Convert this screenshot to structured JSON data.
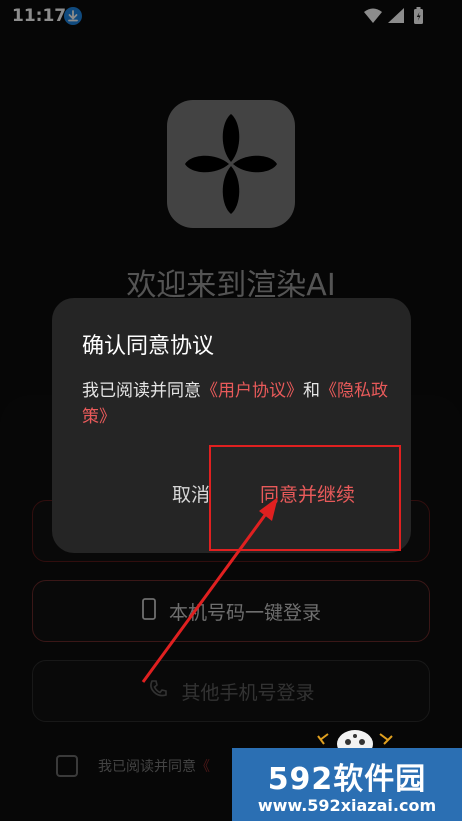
{
  "status_bar": {
    "time": "11:17"
  },
  "welcome_title": "欢迎来到渲染AI",
  "buttons": {
    "hidden_login": "",
    "local_number_login": "本机号码一键登录",
    "other_phone_login": "其他手机号登录"
  },
  "agreement_row": {
    "text_prefix": "我已阅读并同意",
    "link_partial": "《"
  },
  "dialog": {
    "title": "确认同意协议",
    "body_prefix": "我已阅读并同意",
    "user_agreement": "《用户协议》",
    "and": "和",
    "privacy_policy": "《隐私政策》",
    "cancel_label": "取消",
    "accept_label": "同意并继续"
  },
  "watermark": {
    "main": "592软件园",
    "url": "www.592xiazai.com"
  },
  "colors": {
    "accent_red": "#e85a5a",
    "annotation_red": "#e02020",
    "watermark_blue": "#2b6fb3"
  }
}
